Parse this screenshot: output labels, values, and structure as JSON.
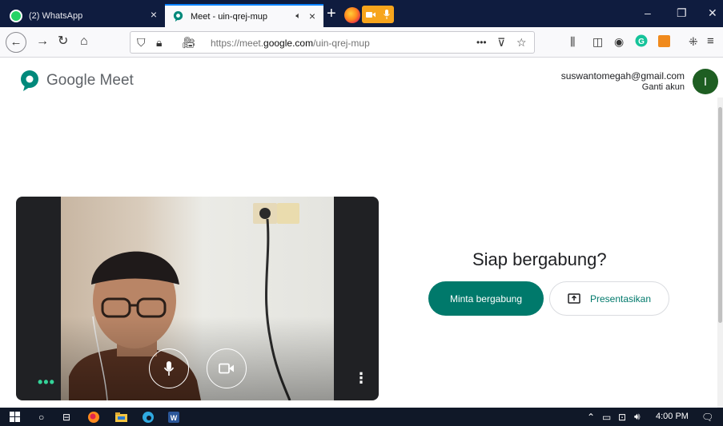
{
  "tabs": [
    {
      "label": "(2) WhatsApp",
      "active": false
    },
    {
      "label": "Meet - uin-qrej-mup",
      "active": true,
      "audio_icon": "speaker-icon"
    }
  ],
  "tab_close_symbol": "×",
  "window_controls": {
    "minimize": "–",
    "restore": "❐",
    "close": "✕"
  },
  "navbar": {
    "url_prefix": "https://meet.",
    "url_domain": "google.com",
    "url_path": "/uin-qrej-mup",
    "page_actions": "•••"
  },
  "header": {
    "brand": "Google Meet",
    "account_email": "suswantomegah@gmail.com",
    "switch_account": "Ganti akun",
    "avatar_letter": "I"
  },
  "join": {
    "title": "Siap bergabung?",
    "join_button": "Minta bergabung",
    "present_button": "Presentasikan"
  },
  "video": {
    "more_options": "⋮",
    "dots": "•••"
  },
  "taskbar": {
    "clock": "4:00 PM"
  },
  "colors": {
    "tabstrip": "#0f1c3f",
    "meet_green": "#00796b",
    "avatar": "#1e5e22",
    "taskbar": "#101828"
  }
}
